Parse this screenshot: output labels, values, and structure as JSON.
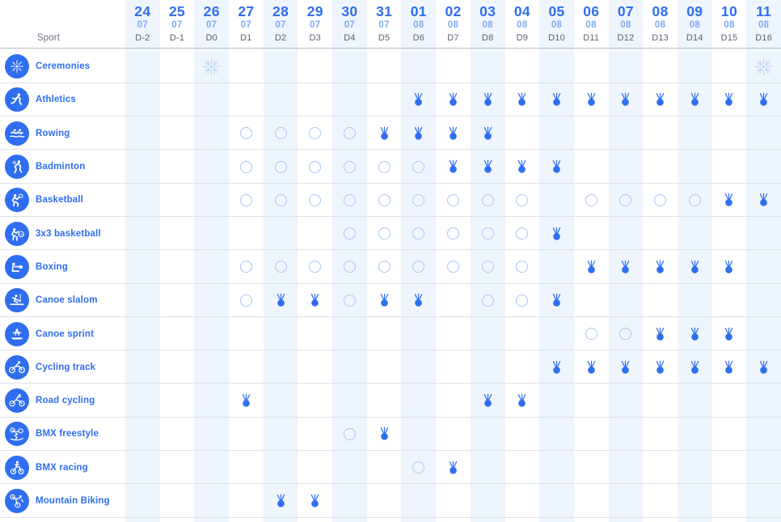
{
  "colors": {
    "brand_blue": "#2f6ef0",
    "light_blue": "#7fa9f5",
    "circle_outline": "#a8c6f6",
    "stripe": "#eef5fd",
    "row_line": "#dfe2e7",
    "header_rule": "#b9bcc2",
    "day_label": "#5c6270",
    "sport_header": "#6f7480"
  },
  "header": {
    "sport_column_label": "Sport",
    "columns": [
      {
        "day": "24",
        "month": "07",
        "dlabel": "D-2"
      },
      {
        "day": "25",
        "month": "07",
        "dlabel": "D-1"
      },
      {
        "day": "26",
        "month": "07",
        "dlabel": "D0"
      },
      {
        "day": "27",
        "month": "07",
        "dlabel": "D1"
      },
      {
        "day": "28",
        "month": "07",
        "dlabel": "D2"
      },
      {
        "day": "29",
        "month": "07",
        "dlabel": "D3"
      },
      {
        "day": "30",
        "month": "07",
        "dlabel": "D4"
      },
      {
        "day": "31",
        "month": "07",
        "dlabel": "D5"
      },
      {
        "day": "01",
        "month": "08",
        "dlabel": "D6"
      },
      {
        "day": "02",
        "month": "08",
        "dlabel": "D7"
      },
      {
        "day": "03",
        "month": "08",
        "dlabel": "D8"
      },
      {
        "day": "04",
        "month": "08",
        "dlabel": "D9"
      },
      {
        "day": "05",
        "month": "08",
        "dlabel": "D10"
      },
      {
        "day": "06",
        "month": "08",
        "dlabel": "D11"
      },
      {
        "day": "07",
        "month": "08",
        "dlabel": "D12"
      },
      {
        "day": "08",
        "month": "08",
        "dlabel": "D13"
      },
      {
        "day": "09",
        "month": "08",
        "dlabel": "D14"
      },
      {
        "day": "10",
        "month": "08",
        "dlabel": "D15"
      },
      {
        "day": "11",
        "month": "08",
        "dlabel": "D16"
      }
    ]
  },
  "legend_semantics": {
    "circle": "event-session",
    "medal": "medal-event",
    "firework": "ceremony"
  },
  "rows": [
    {
      "sport": "Ceremonies",
      "icon": "firework-icon",
      "cells": [
        "",
        "",
        "firework",
        "",
        "",
        "",
        "",
        "",
        "",
        "",
        "",
        "",
        "",
        "",
        "",
        "",
        "",
        "",
        "firework"
      ]
    },
    {
      "sport": "Athletics",
      "icon": "athletics-icon",
      "cells": [
        "",
        "",
        "",
        "",
        "",
        "",
        "",
        "",
        "medal",
        "medal",
        "medal",
        "medal",
        "medal",
        "medal",
        "medal",
        "medal",
        "medal",
        "medal",
        "medal"
      ]
    },
    {
      "sport": "Rowing",
      "icon": "rowing-icon",
      "cells": [
        "",
        "",
        "",
        "circle",
        "circle",
        "circle",
        "circle",
        "medal",
        "medal",
        "medal",
        "medal",
        "",
        "",
        "",
        "",
        "",
        "",
        "",
        ""
      ]
    },
    {
      "sport": "Badminton",
      "icon": "badminton-icon",
      "cells": [
        "",
        "",
        "",
        "circle",
        "circle",
        "circle",
        "circle",
        "circle",
        "circle",
        "medal",
        "medal",
        "medal",
        "medal",
        "",
        "",
        "",
        "",
        "",
        ""
      ]
    },
    {
      "sport": "Basketball",
      "icon": "basketball-icon",
      "cells": [
        "",
        "",
        "",
        "circle",
        "circle",
        "circle",
        "circle",
        "circle",
        "circle",
        "circle",
        "circle",
        "circle",
        "",
        "circle",
        "circle",
        "circle",
        "circle",
        "medal",
        "medal"
      ]
    },
    {
      "sport": "3x3 basketball",
      "icon": "basketball-3x3-icon",
      "cells": [
        "",
        "",
        "",
        "",
        "",
        "",
        "circle",
        "circle",
        "circle",
        "circle",
        "circle",
        "circle",
        "medal",
        "",
        "",
        "",
        "",
        "",
        ""
      ]
    },
    {
      "sport": "Boxing",
      "icon": "boxing-icon",
      "cells": [
        "",
        "",
        "",
        "circle",
        "circle",
        "circle",
        "circle",
        "circle",
        "circle",
        "circle",
        "circle",
        "circle",
        "",
        "medal",
        "medal",
        "medal",
        "medal",
        "medal",
        ""
      ]
    },
    {
      "sport": "Canoe slalom",
      "icon": "canoe-slalom-icon",
      "cells": [
        "",
        "",
        "",
        "circle",
        "medal",
        "medal",
        "circle",
        "medal",
        "medal",
        "",
        "circle",
        "circle",
        "medal",
        "",
        "",
        "",
        "",
        "",
        ""
      ]
    },
    {
      "sport": "Canoe sprint",
      "icon": "canoe-sprint-icon",
      "cells": [
        "",
        "",
        "",
        "",
        "",
        "",
        "",
        "",
        "",
        "",
        "",
        "",
        "",
        "circle",
        "circle",
        "medal",
        "medal",
        "medal",
        ""
      ]
    },
    {
      "sport": "Cycling track",
      "icon": "cycling-track-icon",
      "cells": [
        "",
        "",
        "",
        "",
        "",
        "",
        "",
        "",
        "",
        "",
        "",
        "",
        "medal",
        "medal",
        "medal",
        "medal",
        "medal",
        "medal",
        "medal"
      ]
    },
    {
      "sport": "Road cycling",
      "icon": "road-cycling-icon",
      "cells": [
        "",
        "",
        "",
        "medal",
        "",
        "",
        "",
        "",
        "",
        "",
        "medal",
        "medal",
        "",
        "",
        "",
        "",
        "",
        "",
        ""
      ]
    },
    {
      "sport": "BMX freestyle",
      "icon": "bmx-freestyle-icon",
      "cells": [
        "",
        "",
        "",
        "",
        "",
        "",
        "circle",
        "medal",
        "",
        "",
        "",
        "",
        "",
        "",
        "",
        "",
        "",
        "",
        ""
      ]
    },
    {
      "sport": "BMX racing",
      "icon": "bmx-racing-icon",
      "cells": [
        "",
        "",
        "",
        "",
        "",
        "",
        "",
        "",
        "circle",
        "medal",
        "",
        "",
        "",
        "",
        "",
        "",
        "",
        "",
        ""
      ]
    },
    {
      "sport": "Mountain Biking",
      "icon": "mountain-biking-icon",
      "cells": [
        "",
        "",
        "",
        "",
        "medal",
        "medal",
        "",
        "",
        "",
        "",
        "",
        "",
        "",
        "",
        "",
        "",
        "",
        "",
        ""
      ]
    }
  ]
}
